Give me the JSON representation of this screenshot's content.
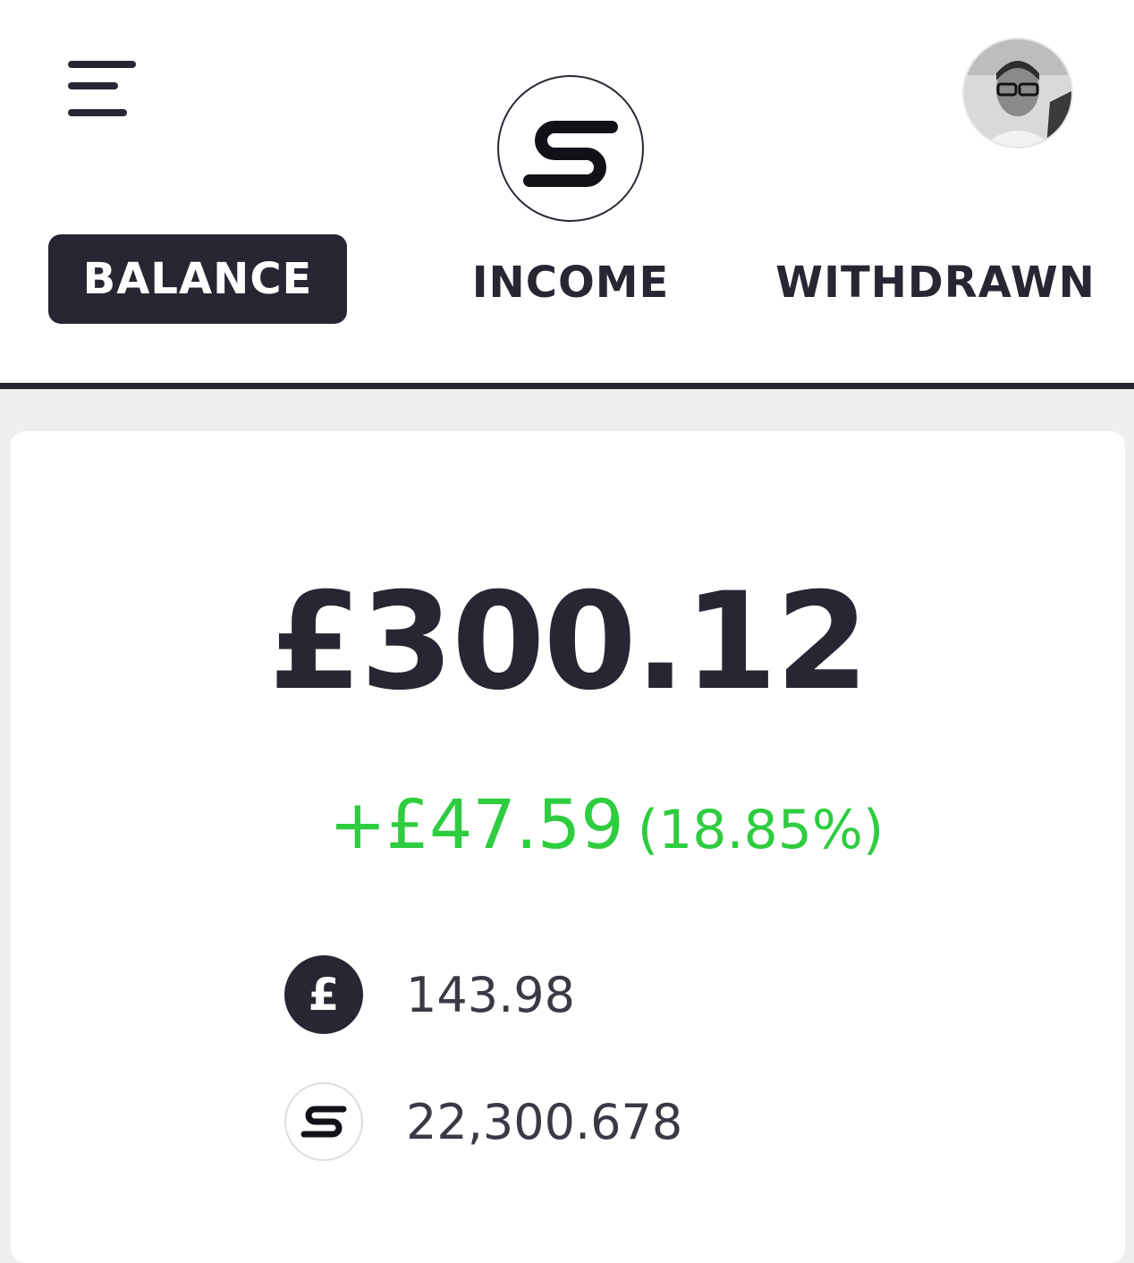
{
  "header": {
    "menu_icon": "hamburger-menu-icon",
    "logo_icon": "s-logo-icon",
    "avatar": "user-avatar",
    "tabs": [
      {
        "label": "BALANCE",
        "active": true
      },
      {
        "label": "INCOME",
        "active": false
      },
      {
        "label": "WITHDRAWN",
        "active": false
      }
    ]
  },
  "balance": {
    "total": "£300.12",
    "change_amount": "+£47.59",
    "change_percent": "(18.85%)",
    "holdings": [
      {
        "icon": "pound-coin-icon",
        "symbol": "£",
        "value": "143.98"
      },
      {
        "icon": "s-token-icon",
        "value": "22,300.678"
      }
    ]
  },
  "colors": {
    "primary": "#272733",
    "positive": "#2ecc3f",
    "background": "#efeeed",
    "card": "#ffffff"
  }
}
